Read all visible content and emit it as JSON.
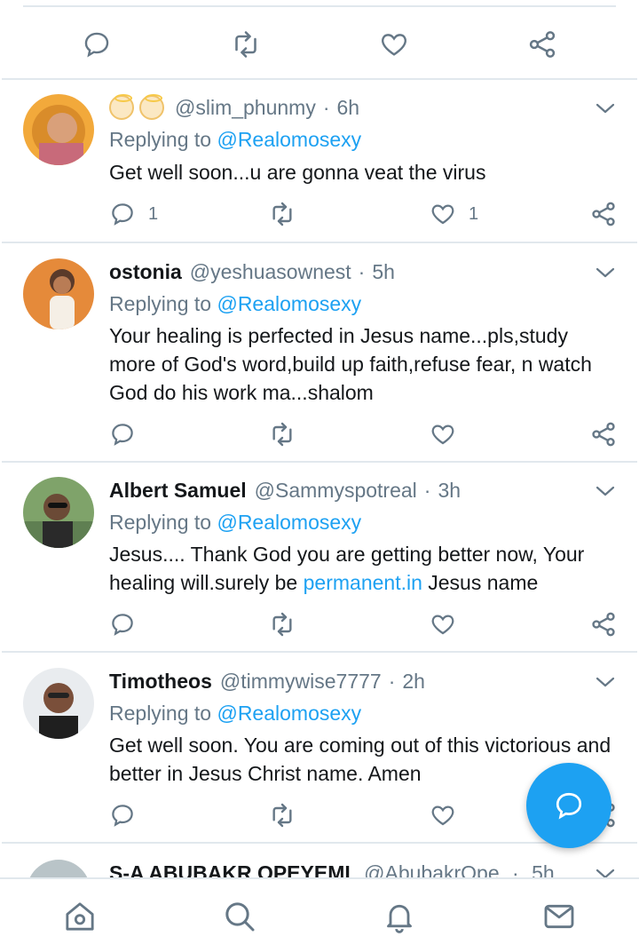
{
  "colors": {
    "accent": "#1da1f2",
    "muted": "#657786",
    "text": "#14171a",
    "divider": "#e1e8ed"
  },
  "top_actions": [
    "reply-icon",
    "retweet-icon",
    "like-icon",
    "share-icon"
  ],
  "tweets": [
    {
      "name": "",
      "handle": "@slim_phunmy",
      "time": "6h",
      "emoji": [
        "angel-emoji",
        "angel-emoji"
      ],
      "replying_prefix": "Replying to",
      "replying_to": "@Realomosexy",
      "text": "Get well soon...u are gonna veat the virus",
      "reply_count": "1",
      "like_count": "1"
    },
    {
      "name": "ostonia",
      "handle": "@yeshuasownest",
      "time": "5h",
      "replying_prefix": "Replying to",
      "replying_to": "@Realomosexy",
      "text": "Your healing is perfected in Jesus name...pls,study more of God's word,build up faith,refuse fear, n watch God do his work ma...shalom"
    },
    {
      "name": "Albert Samuel",
      "handle": "@Sammyspotreal",
      "time": "3h",
      "replying_prefix": "Replying to",
      "replying_to": "@Realomosexy",
      "text_before": "Jesus.... Thank God you are getting better now, Your healing will.surely be ",
      "text_link": "permanent.in",
      "text_after": " Jesus name"
    },
    {
      "name": "Timotheos",
      "handle": "@timmywise7777",
      "time": "2h",
      "replying_prefix": "Replying to",
      "replying_to": "@Realomosexy",
      "text": "Get well soon. You are coming out of this victorious and better in Jesus Christ name. Amen"
    }
  ],
  "partial_tweet": {
    "name": "S-A ABUBAKR OPEYEMI",
    "handle": "@AbubakrOpe",
    "time": "5h"
  },
  "separator": "·",
  "bottom_nav": [
    "home-icon",
    "search-icon",
    "notifications-icon",
    "messages-icon"
  ],
  "fab_icon": "compose-reply-icon"
}
